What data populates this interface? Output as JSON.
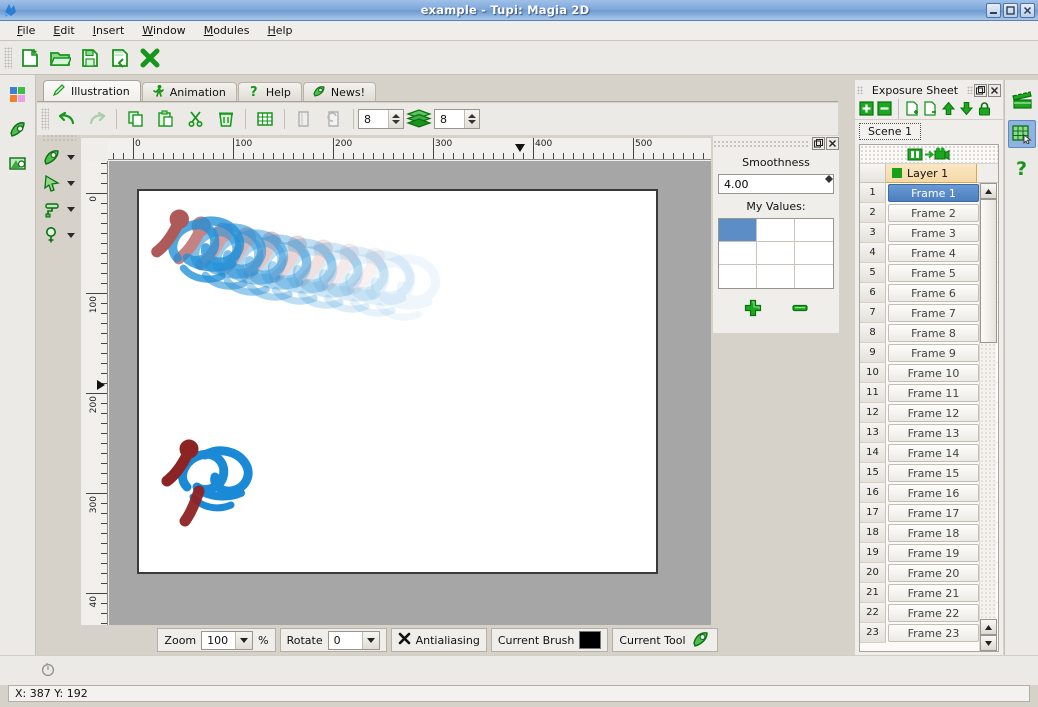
{
  "window": {
    "title": "example - Tupi: Magia 2D",
    "app_icon": "tupi-logo-icon",
    "buttons": [
      {
        "name": "minimize-button",
        "glyph": "_"
      },
      {
        "name": "maximize-button",
        "glyph": "□"
      },
      {
        "name": "close-button",
        "glyph": "✕"
      }
    ]
  },
  "menubar": {
    "items": [
      {
        "label": "File",
        "accel": "F"
      },
      {
        "label": "Edit",
        "accel": "E"
      },
      {
        "label": "Insert",
        "accel": "I"
      },
      {
        "label": "Window",
        "accel": "W"
      },
      {
        "label": "Modules",
        "accel": "M"
      },
      {
        "label": "Help",
        "accel": "H"
      }
    ]
  },
  "main_toolbar": {
    "buttons": [
      {
        "name": "new-project-button",
        "icon": "new-document-icon"
      },
      {
        "name": "open-project-button",
        "icon": "open-folder-icon"
      },
      {
        "name": "save-project-button",
        "icon": "save-document-icon"
      },
      {
        "name": "save-as-button",
        "icon": "save-as-document-icon"
      },
      {
        "name": "close-project-button",
        "icon": "close-x-icon"
      }
    ]
  },
  "left_rail": {
    "buttons": [
      {
        "name": "color-palette-button",
        "icon": "color-squares-icon"
      },
      {
        "name": "brushes-button",
        "icon": "paint-brush-icon"
      },
      {
        "name": "library-button",
        "icon": "library-image-icon"
      }
    ]
  },
  "tool_column": {
    "tools": [
      {
        "name": "tool-pencil",
        "icon": "pencil-nib-icon"
      },
      {
        "name": "tool-selection",
        "icon": "selection-arrow-icon"
      },
      {
        "name": "tool-fill",
        "icon": "paint-roller-icon"
      },
      {
        "name": "tool-magnifier",
        "icon": "magnifier-icon"
      }
    ]
  },
  "tabs": [
    {
      "label": "Illustration",
      "icon": "pencil-icon",
      "active": true
    },
    {
      "label": "Animation",
      "icon": "running-man-icon",
      "active": false
    },
    {
      "label": "Help",
      "icon": "question-mark-icon",
      "active": false
    },
    {
      "label": "News!",
      "icon": "leaf-icon",
      "active": false
    }
  ],
  "edit_toolbar": {
    "buttons": [
      {
        "name": "undo-button",
        "icon": "undo-arrow-icon"
      },
      {
        "name": "redo-button",
        "icon": "redo-arrow-icon"
      },
      {
        "name": "copy-button",
        "icon": "copy-icon"
      },
      {
        "name": "paste-button",
        "icon": "paste-icon"
      },
      {
        "name": "cut-button",
        "icon": "scissors-icon"
      },
      {
        "name": "delete-button",
        "icon": "trash-icon"
      },
      {
        "name": "grid-button",
        "icon": "grid-icon"
      },
      {
        "name": "previous-frame-button",
        "icon": "page-previous-icon"
      },
      {
        "name": "next-frame-button",
        "icon": "page-next-icon"
      }
    ],
    "onion_prev": {
      "label": "8",
      "name": "onion-skin-previous-spin"
    },
    "onion_icon": "onion-skin-layers-icon",
    "onion_next": {
      "label": "8",
      "name": "onion-skin-next-spin"
    }
  },
  "rulers": {
    "horizontal": {
      "labels": [
        "0",
        "100",
        "200",
        "300",
        "400",
        "500"
      ],
      "marker_value": 387
    },
    "vertical": {
      "labels": [
        "0",
        "100",
        "200",
        "300",
        "40"
      ],
      "marker_value": 192
    }
  },
  "canvas": {
    "name": "drawing-canvas",
    "artwork_description": "blue butterfly brush strokes with onion-skin trail"
  },
  "smoothness_panel": {
    "title": "Smoothness",
    "float_button": "undock-icon",
    "close_button": "close-icon",
    "value": "4.00",
    "values_label": "My Values:",
    "grid_cells": 9,
    "selected_cell_index": 0,
    "add_button": {
      "name": "add-value-button",
      "icon": "plus-icon"
    },
    "remove_button": {
      "name": "remove-value-button",
      "icon": "minus-icon"
    }
  },
  "exposure_sheet": {
    "title": "Exposure Sheet",
    "float_button": "undock-icon",
    "close_button": "close-icon",
    "toolbar": [
      {
        "name": "add-frame-button",
        "icon": "plus-box-icon"
      },
      {
        "name": "remove-frame-button",
        "icon": "minus-box-icon"
      },
      {
        "name": "insert-layer-button",
        "icon": "layer-add-icon"
      },
      {
        "name": "remove-layer-button",
        "icon": "layer-remove-icon"
      },
      {
        "name": "move-up-button",
        "icon": "arrow-up-icon"
      },
      {
        "name": "move-down-button",
        "icon": "arrow-down-icon"
      },
      {
        "name": "lock-button",
        "icon": "lock-icon"
      }
    ],
    "scene_tab": "Scene 1",
    "sheet_icon_row": "filmstrip-to-camera-icon",
    "layer_header": "Layer 1",
    "layer_color": "#19a019",
    "frames": [
      {
        "num": "1",
        "label": "Frame 1",
        "selected": true
      },
      {
        "num": "2",
        "label": "Frame 2",
        "selected": false
      },
      {
        "num": "3",
        "label": "Frame 3",
        "selected": false
      },
      {
        "num": "4",
        "label": "Frame 4",
        "selected": false
      },
      {
        "num": "5",
        "label": "Frame 5",
        "selected": false
      },
      {
        "num": "6",
        "label": "Frame 6",
        "selected": false
      },
      {
        "num": "7",
        "label": "Frame 7",
        "selected": false
      },
      {
        "num": "8",
        "label": "Frame 8",
        "selected": false
      },
      {
        "num": "9",
        "label": "Frame 9",
        "selected": false
      },
      {
        "num": "10",
        "label": "Frame 10",
        "selected": false
      },
      {
        "num": "11",
        "label": "Frame 11",
        "selected": false
      },
      {
        "num": "12",
        "label": "Frame 12",
        "selected": false
      },
      {
        "num": "13",
        "label": "Frame 13",
        "selected": false
      },
      {
        "num": "14",
        "label": "Frame 14",
        "selected": false
      },
      {
        "num": "15",
        "label": "Frame 15",
        "selected": false
      },
      {
        "num": "16",
        "label": "Frame 16",
        "selected": false
      },
      {
        "num": "17",
        "label": "Frame 17",
        "selected": false
      },
      {
        "num": "18",
        "label": "Frame 18",
        "selected": false
      },
      {
        "num": "19",
        "label": "Frame 19",
        "selected": false
      },
      {
        "num": "20",
        "label": "Frame 20",
        "selected": false
      },
      {
        "num": "21",
        "label": "Frame 21",
        "selected": false
      },
      {
        "num": "22",
        "label": "Frame 22",
        "selected": false
      },
      {
        "num": "23",
        "label": "Frame 23",
        "selected": false
      }
    ]
  },
  "right_rail": {
    "buttons": [
      {
        "name": "animation-module-button",
        "icon": "clapperboard-icon",
        "active": false
      },
      {
        "name": "exposure-sheet-module-button",
        "icon": "exposure-sheet-icon",
        "active": true
      },
      {
        "name": "help-module-button",
        "icon": "question-mark-icon",
        "active": false
      }
    ]
  },
  "bottom_bar": {
    "zoom_label": "Zoom",
    "zoom_value": "100",
    "zoom_unit": "%",
    "rotate_label": "Rotate",
    "rotate_value": "0",
    "antialiasing_label": "Antialiasing",
    "antialiasing_checked": true,
    "current_brush_label": "Current Brush",
    "current_brush_color": "#000000",
    "current_tool_label": "Current Tool",
    "current_tool_icon": "pencil-nib-icon"
  },
  "status_bar": {
    "coordinates": "X: 387 Y: 192",
    "rotation_dial": "rotation-dial-icon"
  }
}
